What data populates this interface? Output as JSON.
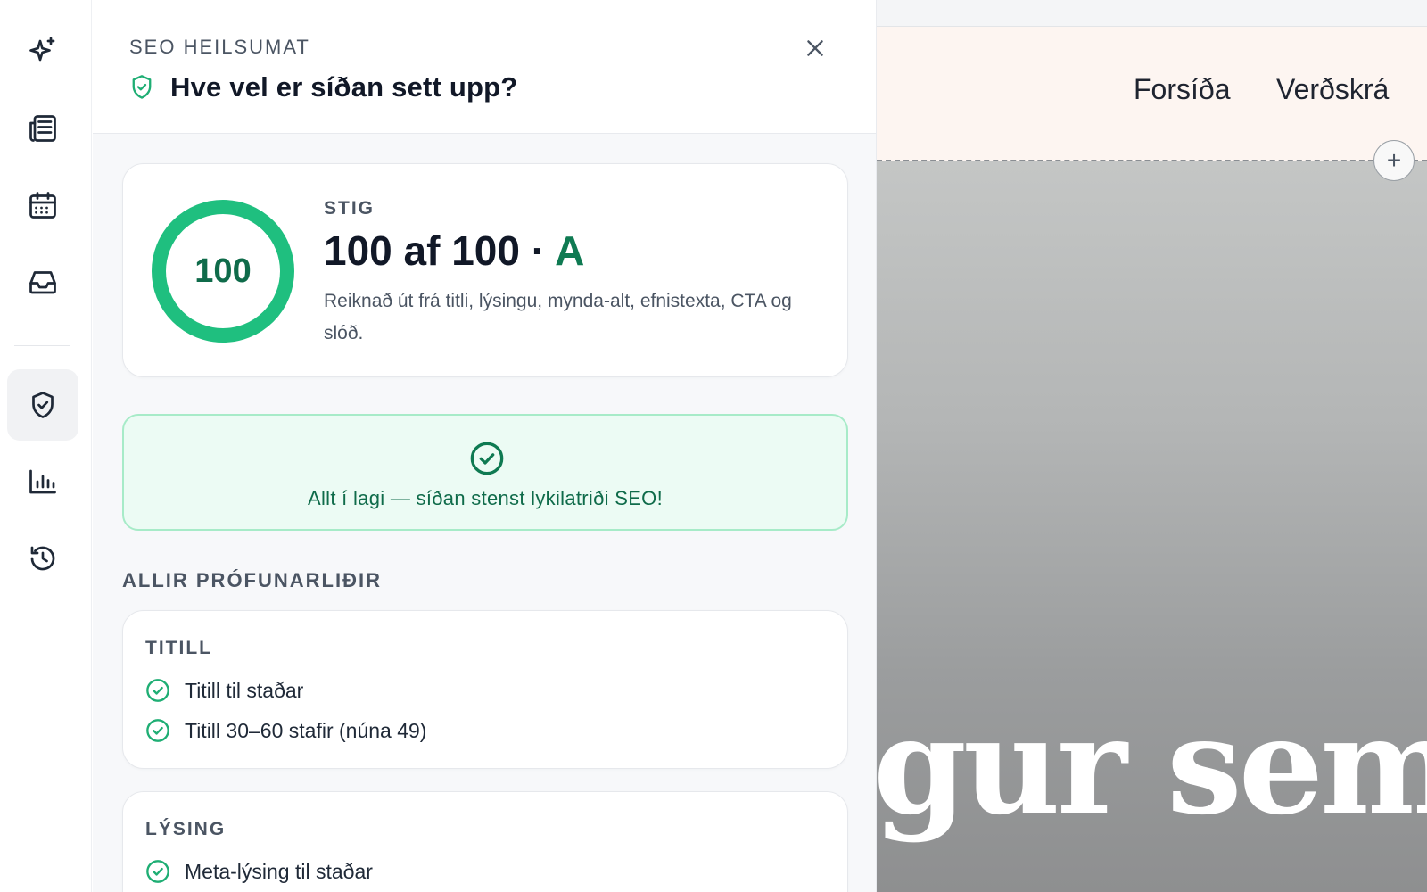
{
  "rail": {
    "items": [
      {
        "icon": "sparkles-icon",
        "active": false
      },
      {
        "icon": "newspaper-icon",
        "active": false
      },
      {
        "icon": "calendar-icon",
        "active": false
      },
      {
        "icon": "inbox-icon",
        "active": false
      },
      {
        "icon": "shield-check-icon",
        "active": true
      },
      {
        "icon": "bar-chart-icon",
        "active": false
      },
      {
        "icon": "history-icon",
        "active": false
      }
    ]
  },
  "panel": {
    "eyebrow": "SEO HEILSUMAT",
    "title": "Hve vel er síðan sett upp?",
    "close_icon": "close-icon",
    "score": {
      "ring_value": "100",
      "progress": 1.0,
      "label": "STIG",
      "main": "100 af 100 · ",
      "grade": "A",
      "description": "Reiknað út frá titli, lýsingu, mynda-alt, efnistexta, CTA og slóð."
    },
    "banner": {
      "text": "Allt í lagi — síðan stenst lykilatriði SEO!"
    },
    "section_title": "ALLIR PRÓFUNARLIÐIR",
    "checks": [
      {
        "title": "TITILL",
        "items": [
          "Titill til staðar",
          "Titill 30–60 stafir (núna 49)"
        ]
      },
      {
        "title": "LÝSING",
        "items": [
          "Meta-lýsing til staðar"
        ]
      }
    ]
  },
  "preview": {
    "nav": [
      "Forsíða",
      "Verðskrá"
    ],
    "add_label": "+",
    "hero_text": "gur sem g"
  },
  "colors": {
    "accent_green": "#1fbf7f",
    "dark_green": "#0f6b4a",
    "banner_bg": "#ecfbf4"
  }
}
